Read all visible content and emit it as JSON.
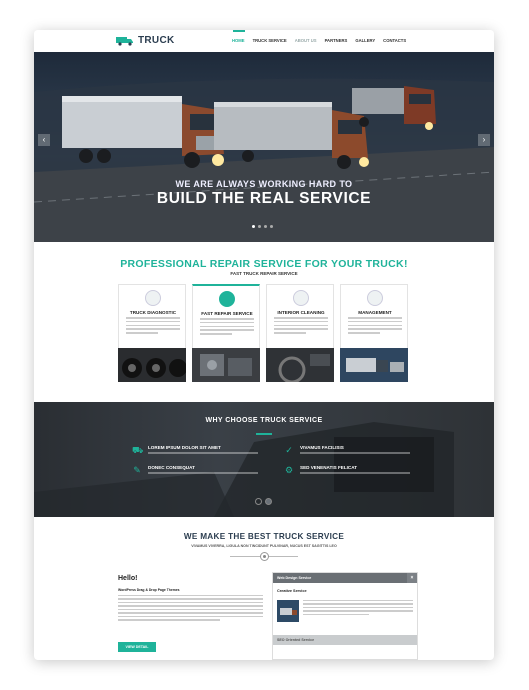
{
  "header": {
    "logo_text": "TRUCK",
    "nav": [
      "HOME",
      "TRUCK SERVICE",
      "ABOUT US",
      "PARTNERS",
      "GALLERY",
      "CONTACTS"
    ],
    "active_nav": "HOME"
  },
  "hero": {
    "line1": "WE ARE ALWAYS WORKING HARD TO",
    "line2": "BUILD THE REAL SERVICE",
    "prev": "‹",
    "next": "›"
  },
  "services": {
    "title": "PROFESSIONAL REPAIR SERVICE FOR YOUR TRUCK!",
    "subtitle": "FAST TRUCK REPAIR SERVICE",
    "items": [
      {
        "name": "TRUCK DIAGNOSTIC",
        "icon": "diagnostic-icon"
      },
      {
        "name": "FAST REPAIR SERVICE",
        "icon": "wrench-icon"
      },
      {
        "name": "INTERIOR CLEANING",
        "icon": "steering-wheel-icon"
      },
      {
        "name": "MANAGEMENT",
        "icon": "manager-icon"
      }
    ]
  },
  "why": {
    "title": "WHY CHOOSE TRUCK SERVICE",
    "features": [
      {
        "title": "LOREM IPSUM DOLOR SIT AMET",
        "icon": "truck-icon"
      },
      {
        "title": "VIVAMUS FACILISIS",
        "icon": "check-icon"
      },
      {
        "title": "DONEC CONSEQUAT",
        "icon": "wrench-icon"
      },
      {
        "title": "SED VENENATIS FELICAT",
        "icon": "gears-icon"
      }
    ]
  },
  "best": {
    "title": "WE MAKE THE BEST TRUCK SERVICE",
    "subtitle": "VIVAMUS VIVERRA, LIGULA NON TINCIDUNT PULVINAR, NUCUS EST SAGITTIS LEO"
  },
  "hello": {
    "title": "Hello!",
    "subtitle": "WordPress Drag & Drop Page Themes",
    "button": "VIEW DETAIL"
  },
  "accordion": {
    "head1": "Web Design Service",
    "item_title": "Creative Service",
    "head2": "SEO Oriented Service",
    "toggle": "×"
  },
  "colors": {
    "accent": "#1fb39a",
    "dark": "#2c3e50"
  }
}
